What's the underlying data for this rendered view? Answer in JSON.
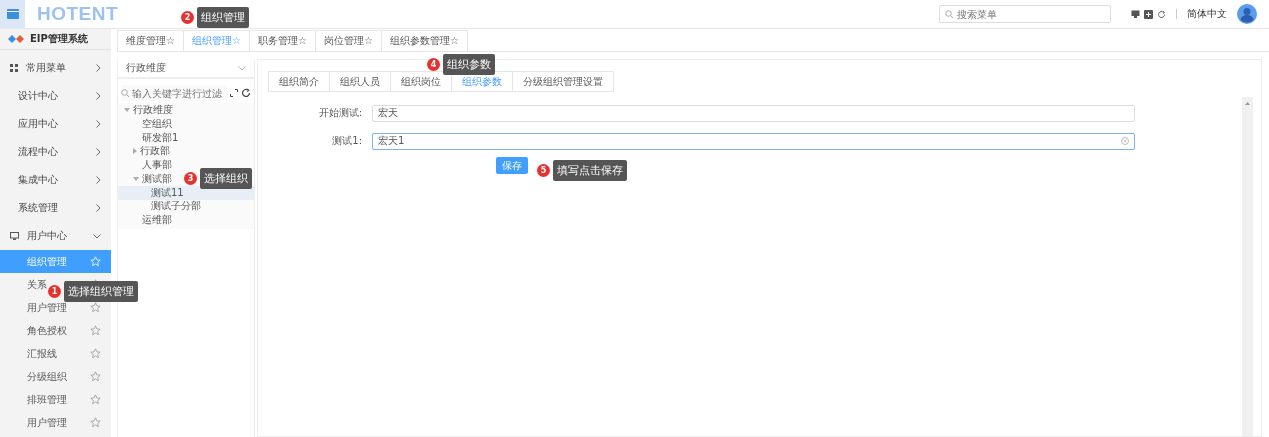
{
  "header": {
    "logo": "HOTENT",
    "search": {
      "placeholder": "搜索菜单"
    },
    "language": "简体中文"
  },
  "sidebar": {
    "title": "EIP管理系统",
    "items": [
      {
        "label": "常用菜单",
        "kind": "grid",
        "expanded": false
      },
      {
        "label": "设计中心",
        "kind": "plain",
        "expanded": false
      },
      {
        "label": "应用中心",
        "kind": "plain",
        "expanded": false
      },
      {
        "label": "流程中心",
        "kind": "plain",
        "expanded": false
      },
      {
        "label": "集成中心",
        "kind": "plain",
        "expanded": false
      },
      {
        "label": "系统管理",
        "kind": "plain",
        "expanded": false
      },
      {
        "label": "用户中心",
        "kind": "monitor",
        "expanded": true,
        "children": [
          {
            "label": "组织管理",
            "selected": true
          },
          {
            "label": "关系",
            "selected": false
          },
          {
            "label": "用户管理",
            "selected": false
          },
          {
            "label": "角色授权",
            "selected": false
          },
          {
            "label": "汇报线",
            "selected": false
          },
          {
            "label": "分级组织",
            "selected": false
          },
          {
            "label": "排班管理",
            "selected": false
          },
          {
            "label": "用户管理",
            "selected": false
          }
        ]
      }
    ]
  },
  "page_tabs": [
    {
      "label": "维度管理☆",
      "selected": false
    },
    {
      "label": "组织管理☆",
      "selected": true
    },
    {
      "label": "职务管理☆",
      "selected": false
    },
    {
      "label": "岗位管理☆",
      "selected": false
    },
    {
      "label": "组织参数管理☆",
      "selected": false
    }
  ],
  "tree": {
    "dimension": "行政维度",
    "filter": {
      "placeholder": "输入关键字进行过滤"
    },
    "nodes": [
      {
        "label": "行政维度",
        "expanded": true,
        "selected": false,
        "children": [
          {
            "label": "空组织",
            "selected": false
          },
          {
            "label": "研发部1",
            "selected": false
          },
          {
            "label": "行政部",
            "expanded": false,
            "selected": false
          },
          {
            "label": "人事部",
            "selected": false
          },
          {
            "label": "测试部",
            "expanded": true,
            "selected": false,
            "children": [
              {
                "label": "测试11",
                "selected": true
              },
              {
                "label": "测试子分部",
                "selected": false
              }
            ]
          },
          {
            "label": "运维部",
            "selected": false
          }
        ]
      }
    ]
  },
  "sub_tabs": [
    {
      "label": "组织简介",
      "selected": false
    },
    {
      "label": "组织人员",
      "selected": false
    },
    {
      "label": "组织岗位",
      "selected": false
    },
    {
      "label": "组织参数",
      "selected": true
    },
    {
      "label": "分级组织管理设置",
      "selected": false
    }
  ],
  "form": {
    "fields": [
      {
        "label": "开始测试:",
        "value": "宏天",
        "focused": false
      },
      {
        "label": "测试1:",
        "value": "宏天1",
        "focused": true
      }
    ],
    "save_button": "保存"
  },
  "annotations": [
    {
      "number": "1",
      "text": "选择组织管理"
    },
    {
      "number": "2",
      "text": "组织管理"
    },
    {
      "number": "3",
      "text": "选择组织"
    },
    {
      "number": "4",
      "text": "组织参数"
    },
    {
      "number": "5",
      "text": "填写点击保存"
    }
  ]
}
